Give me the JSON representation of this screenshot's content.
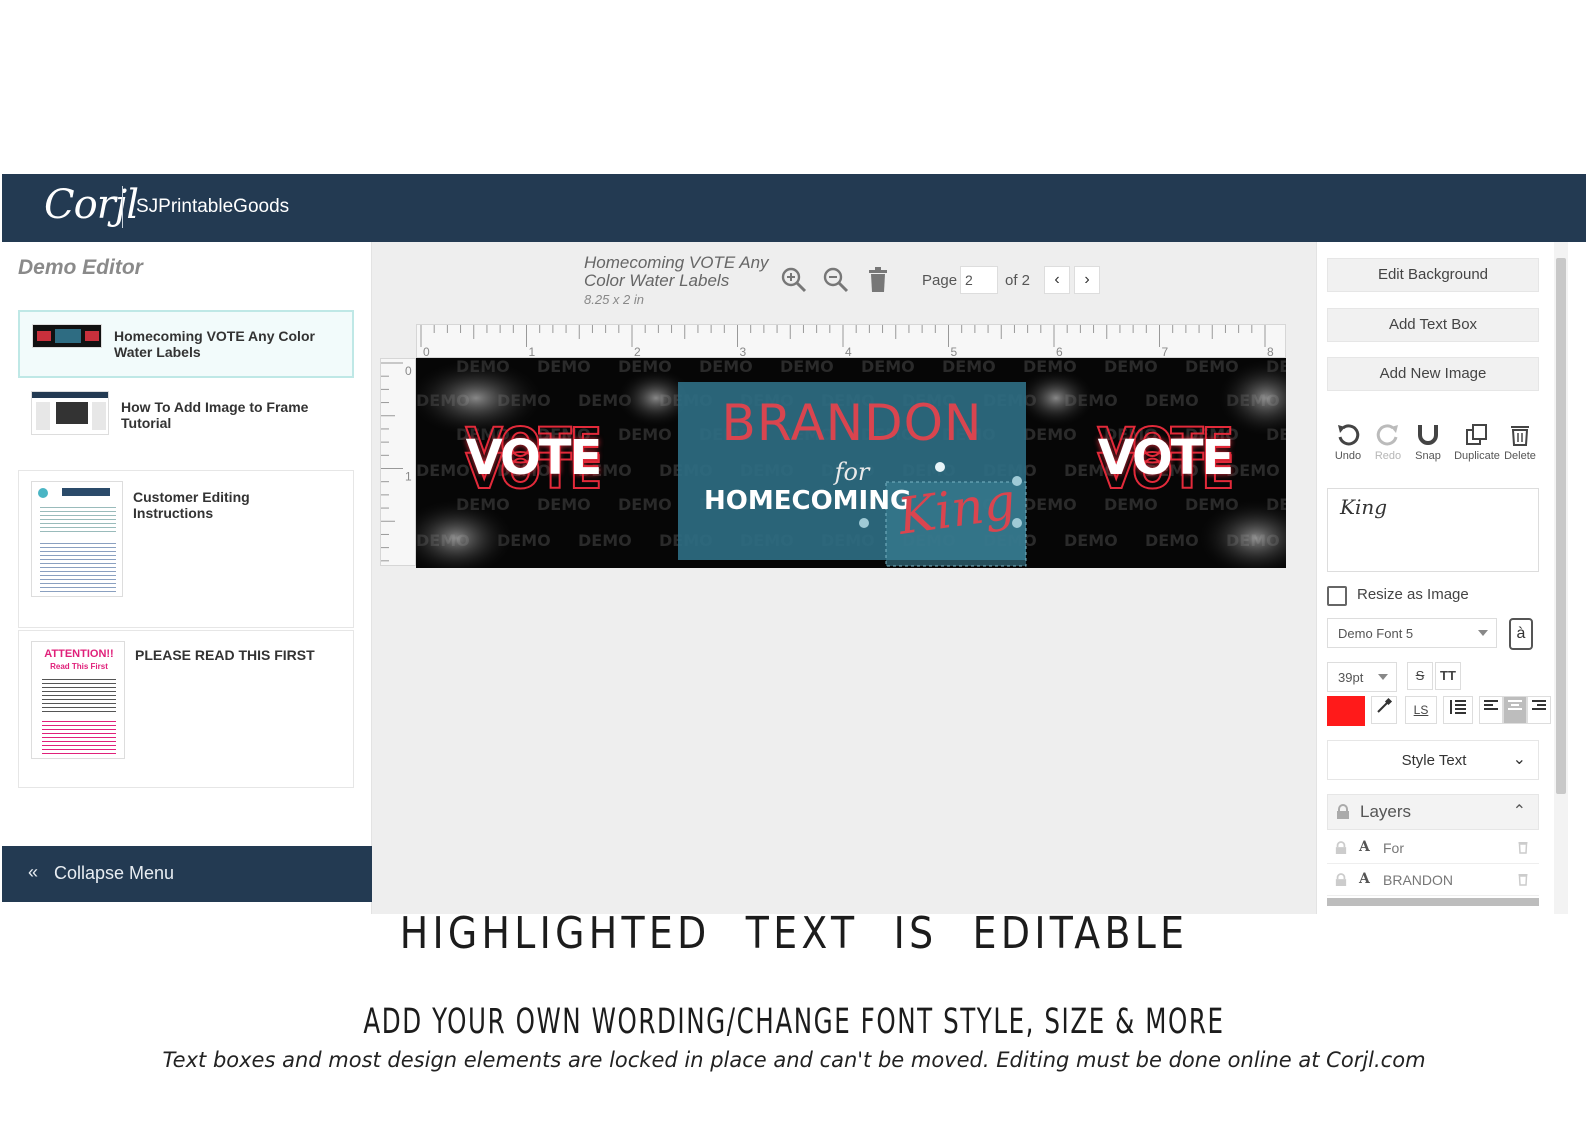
{
  "header": {
    "logo": "Corjl",
    "store": "SJPrintableGoods"
  },
  "sidebar": {
    "title": "Demo Editor",
    "documents": [
      {
        "name": "Homecoming VOTE Any Color Water Labels",
        "active": true
      },
      {
        "name": "How To Add Image to Frame Tutorial",
        "active": false
      },
      {
        "name": "Customer Editing Instructions",
        "active": false
      },
      {
        "name": "PLEASE READ THIS FIRST",
        "active": false
      }
    ],
    "thumb_attention": {
      "title": "ATTENTION!!",
      "subtitle": "Read This First"
    },
    "collapse_label": "Collapse Menu"
  },
  "workspace": {
    "doc_title": "Homecoming VOTE Any Color Water Labels",
    "doc_size": "8.25 x 2 in",
    "page_label": "Page",
    "page_value": "2",
    "page_of": "of 2",
    "ruler_h": [
      "0",
      "1",
      "2",
      "3",
      "4",
      "5",
      "6",
      "7",
      "8"
    ],
    "ruler_v": [
      "0",
      "1"
    ]
  },
  "design": {
    "watermark": "DEMO",
    "vote_left": "VOTE",
    "vote_right": "VOTE",
    "name": "BRANDON",
    "for": "for",
    "event": "HOMECOMING",
    "title_word": "King",
    "name_color": "#d9454f",
    "box_color": "#2e6c82"
  },
  "right_panel": {
    "edit_background": "Edit Background",
    "add_text_box": "Add Text Box",
    "add_new_image": "Add New Image",
    "tools": [
      "Undo",
      "Redo",
      "Snap",
      "Duplicate",
      "Delete"
    ],
    "text_value": "King",
    "resize_as_image": "Resize as Image",
    "font": "Demo Font 5",
    "font_size": "39pt",
    "text_color": "#ff1a1a",
    "style_text": "Style Text",
    "layers_title": "Layers",
    "layers": [
      "For",
      "BRANDON"
    ]
  },
  "captions": {
    "line1": "HIGHLIGHTED TEXT IS EDITABLE",
    "line2": "ADD YOUR OWN WORDING/CHANGE FONT STYLE, SIZE & MORE",
    "line3": "Text boxes and most design elements are locked in place and can't be moved. Editing must be done online at Corjl.com"
  }
}
